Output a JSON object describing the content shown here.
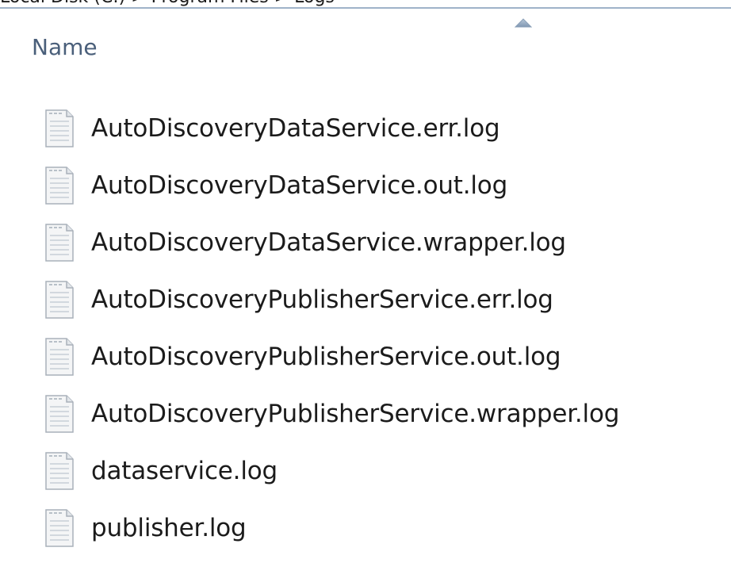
{
  "top_strip": {
    "text": "Local Disk (C:) > Program Files > Logs"
  },
  "column_header": {
    "label": "Name",
    "sort_icon": "sort-ascending-arrow-icon"
  },
  "files": [
    {
      "name": "AutoDiscoveryDataService.err.log",
      "icon": "text-file-icon"
    },
    {
      "name": "AutoDiscoveryDataService.out.log",
      "icon": "text-file-icon"
    },
    {
      "name": "AutoDiscoveryDataService.wrapper.log",
      "icon": "text-file-icon"
    },
    {
      "name": "AutoDiscoveryPublisherService.err.log",
      "icon": "text-file-icon"
    },
    {
      "name": "AutoDiscoveryPublisherService.out.log",
      "icon": "text-file-icon"
    },
    {
      "name": "AutoDiscoveryPublisherService.wrapper.log",
      "icon": "text-file-icon"
    },
    {
      "name": "dataservice.log",
      "icon": "text-file-icon"
    },
    {
      "name": "publisher.log",
      "icon": "text-file-icon"
    }
  ],
  "colors": {
    "header_text": "#4a5f7a",
    "divider": "#9fb3c9",
    "file_text": "#1b1b1b"
  }
}
